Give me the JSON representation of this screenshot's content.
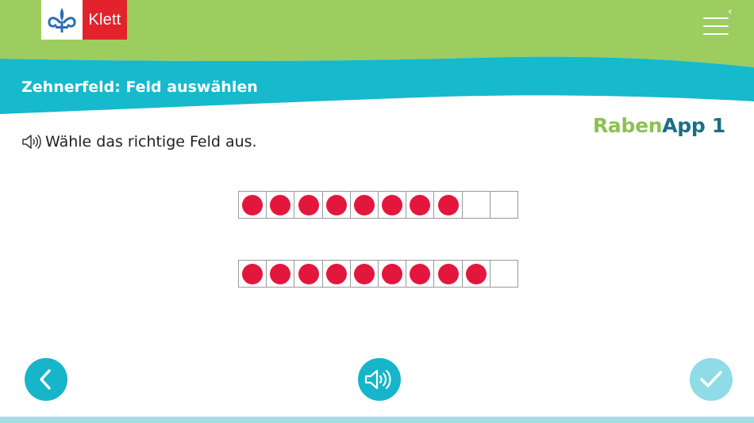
{
  "header": {
    "logo_text": "Klett",
    "page_title": "Zehnerfeld: Feld auswählen",
    "colors": {
      "green": "#9ccd5e",
      "teal": "#17b9cc",
      "logo_red": "#e2232b"
    },
    "menu_icon": "hamburger-menu-icon",
    "collapse_icon": "chevron-left-icon"
  },
  "brand": {
    "part1": "Raben",
    "part2": "App 1"
  },
  "task": {
    "instruction": "Wähle das richtige Feld aus.",
    "speaker_icon": "speaker-icon"
  },
  "ten_frames": [
    {
      "filled": 8,
      "total": 10
    },
    {
      "filled": 9,
      "total": 10
    }
  ],
  "footer": {
    "back_icon": "chevron-left-icon",
    "audio_icon": "speaker-icon",
    "check_icon": "checkmark-icon"
  }
}
